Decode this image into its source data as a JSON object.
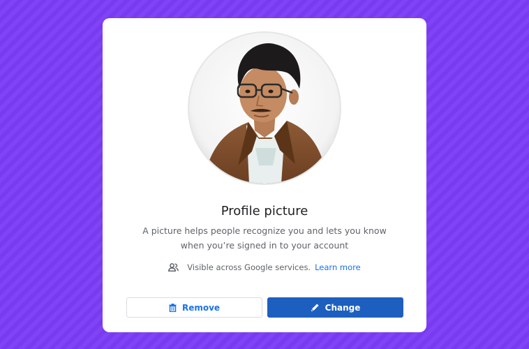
{
  "dialog": {
    "title": "Profile picture",
    "description_line1": "A picture helps people recognize you and lets you know",
    "description_line2": "when you’re signed in to your account",
    "visibility_text": "Visible across Google services.",
    "learn_more_label": "Learn more"
  },
  "buttons": {
    "remove_label": "Remove",
    "change_label": "Change"
  },
  "icons": {
    "visibility": "people-icon",
    "remove": "trash-icon",
    "change": "pencil-icon"
  },
  "colors": {
    "background": "#7b3cf5",
    "card": "#ffffff",
    "primary": "#1d5fbf",
    "link": "#1a73e8",
    "text_primary": "#202124",
    "text_secondary": "#5f6368"
  }
}
